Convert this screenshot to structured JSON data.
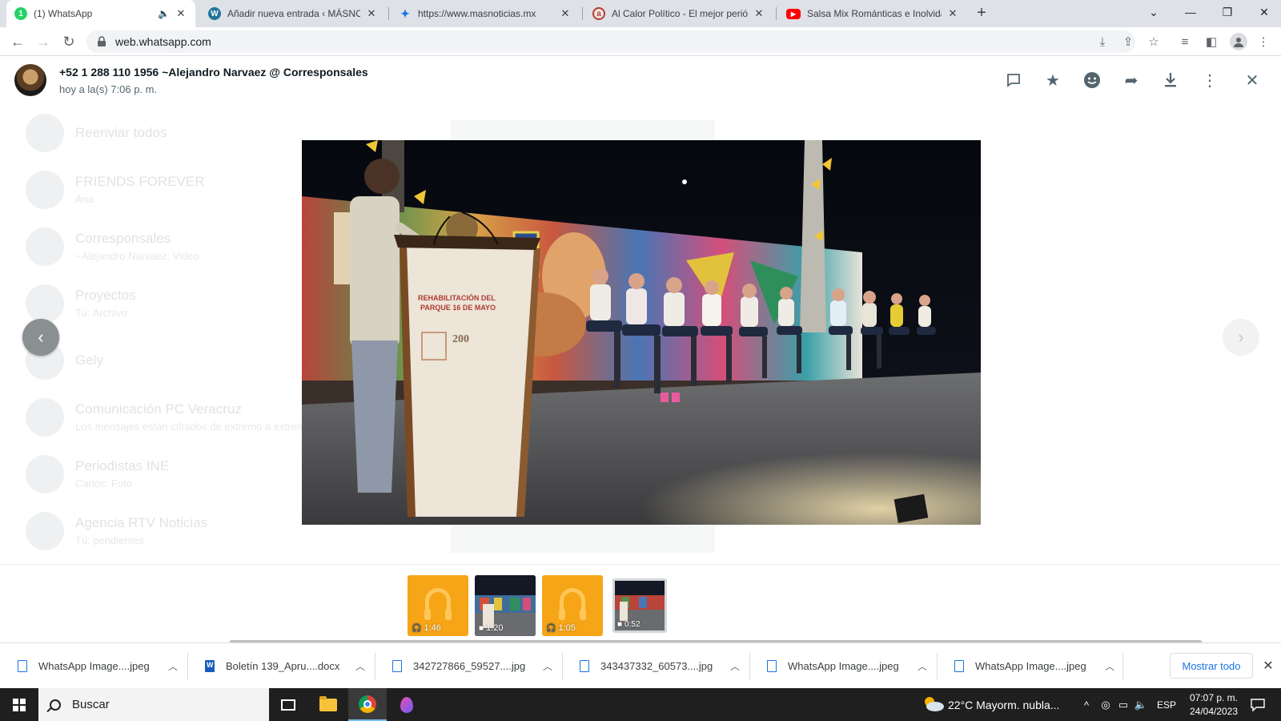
{
  "browser": {
    "tabs": [
      {
        "title": "(1) WhatsApp",
        "favicon": "whatsapp-icon",
        "active": true,
        "audio": true
      },
      {
        "title": "Añadir nueva entrada ‹ MÁSNOTICIAS",
        "favicon": "wordpress-icon"
      },
      {
        "title": "https://www.masnoticias.mx",
        "favicon": "loading-icon"
      },
      {
        "title": "Al Calor Político - El mejor periódico",
        "favicon": "alcalor-icon"
      },
      {
        "title": "Salsa Mix Románticas e Inolvidables",
        "favicon": "youtube-icon"
      }
    ],
    "url": "web.whatsapp.com"
  },
  "viewer": {
    "sender": "+52 1 288 110 1956 ~Alejandro Narvaez @ Corresponsales",
    "timestamp": "hoy a la(s) 7:06 p. m.",
    "podium_text": [
      "REHABILITACIÓN DEL",
      "PARQUE 16 DE MAYO"
    ],
    "podium_badge": "200",
    "thumbnails": [
      {
        "type": "audio",
        "duration": "1:46"
      },
      {
        "type": "video",
        "duration": "1:20"
      },
      {
        "type": "audio",
        "duration": "1:05"
      },
      {
        "type": "video",
        "duration": "0:52",
        "selected": true
      }
    ],
    "background_chats": [
      {
        "title": "Reenviar todos",
        "subtitle": ""
      },
      {
        "title": "FRIENDS FOREVER",
        "subtitle": "Ana"
      },
      {
        "title": "Corresponsales",
        "subtitle": "~Alejandro Narvaez: Video"
      },
      {
        "title": "Proyectos",
        "subtitle": "Tú: Archivo"
      },
      {
        "title": "Gely",
        "subtitle": ""
      },
      {
        "title": "Comunicación PC Veracruz",
        "subtitle": "Los mensajes están cifrados de extremo a extremo"
      },
      {
        "title": "Periodistas INE",
        "subtitle": "Carlos: Foto"
      },
      {
        "title": "Agencia RTV Noticias",
        "subtitle": "Tú: pendientes"
      }
    ]
  },
  "downloads": {
    "items": [
      {
        "name": "WhatsApp Image....jpeg",
        "kind": "image"
      },
      {
        "name": "Boletín 139_Apru....docx",
        "kind": "word"
      },
      {
        "name": "342727866_59527....jpg",
        "kind": "image"
      },
      {
        "name": "343437332_60573....jpg",
        "kind": "image"
      },
      {
        "name": "WhatsApp Image....jpeg",
        "kind": "image"
      },
      {
        "name": "WhatsApp Image....jpeg",
        "kind": "image"
      }
    ],
    "show_all": "Mostrar todo"
  },
  "taskbar": {
    "search_placeholder": "Buscar",
    "weather": "22°C  Mayorm. nubla...",
    "language": "ESP",
    "time": "07:07 p. m.",
    "date": "24/04/2023"
  },
  "colors": {
    "accent_blue": "#1a73e8",
    "audio_thumb": "#f6a517",
    "taskbar": "#1f1f1f"
  }
}
